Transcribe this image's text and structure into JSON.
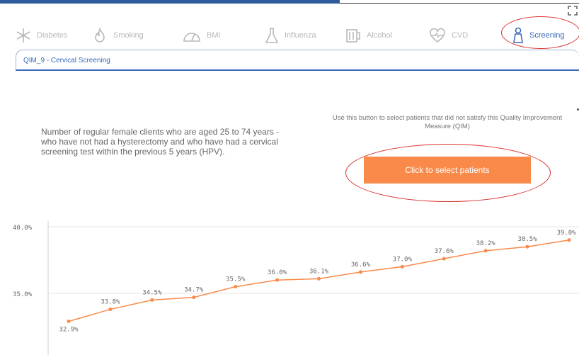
{
  "tabs": [
    {
      "label": "Diabetes",
      "icon": "asterisk-icon",
      "active": false
    },
    {
      "label": "Smoking",
      "icon": "flame-icon",
      "active": false
    },
    {
      "label": "BMI",
      "icon": "gauge-icon",
      "active": false
    },
    {
      "label": "Influenza",
      "icon": "flask-icon",
      "active": false
    },
    {
      "label": "Alcohol",
      "icon": "glass-icon",
      "active": false
    },
    {
      "label": "CVD",
      "icon": "heart-pulse-icon",
      "active": false
    },
    {
      "label": "Screening",
      "icon": "person-icon",
      "active": true
    }
  ],
  "subtab": {
    "label": "QIM_9 - Cervical Screening"
  },
  "description": "Number of regular female clients who are aged 25 to 74 years - who have not had a hysterectomy and who have had a cervical screening test within the previous 5 years (HPV).",
  "instruction": "Use this button to select patients that did not satisfy this Quality Improvement Measure (QIM)",
  "select_button": "Click to select patients",
  "colors": {
    "accent": "#3b6ab8",
    "button": "#f98a4a",
    "line": "#f98a4a",
    "highlight": "#d9322e"
  },
  "chart_data": {
    "type": "line",
    "y_ticks": [
      "40.0%",
      "35.0%"
    ],
    "ylim": [
      30.8,
      40.0
    ],
    "values": [
      32.9,
      33.8,
      34.5,
      34.7,
      35.5,
      36.0,
      36.1,
      36.6,
      37.0,
      37.6,
      38.2,
      38.5,
      39.0
    ],
    "labels": [
      "32.9%",
      "33.8%",
      "34.5%",
      "34.7%",
      "35.5%",
      "36.0%",
      "36.1%",
      "36.6%",
      "37.0%",
      "37.6%",
      "38.2%",
      "38.5%",
      "39.0%"
    ],
    "grid": true
  }
}
